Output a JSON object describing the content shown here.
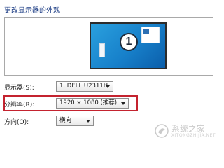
{
  "page_title": "更改显示器的外观",
  "preview": {
    "monitor_number": "1"
  },
  "display": {
    "label": "显示器(S):",
    "value": "1. DELL U2311H"
  },
  "resolution": {
    "label": "分辨率(R):",
    "value": "1920 × 1080 (推荐)"
  },
  "orientation": {
    "label": "方向(O):",
    "value": "横向"
  },
  "watermark": {
    "text": "系统之家",
    "sub": "XITONGZHIJIA.NET"
  },
  "colors": {
    "title": "#1f3f86",
    "highlight": "#c4232f",
    "monitor": "#1780ca"
  }
}
